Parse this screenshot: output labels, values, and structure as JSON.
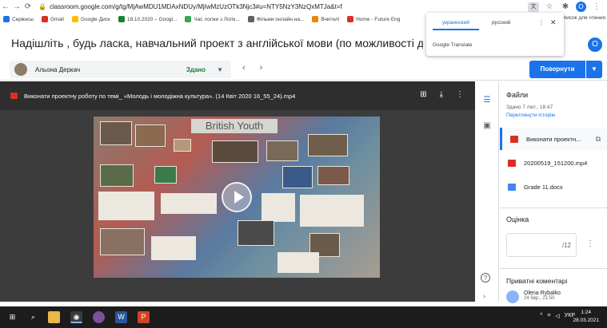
{
  "browser": {
    "url": "classroom.google.com/g/tg/MjAwMDU1MDAxNDUy/MjIwMzUzOTk3Njc3#u=NTY5NzY3NzQxMTJa&t=f",
    "bookmarks": [
      {
        "label": "Сервисы",
        "color": "#1a73e8"
      },
      {
        "label": "Gmail",
        "color": "#d93025"
      },
      {
        "label": "Google Диск",
        "color": "#fbbc04"
      },
      {
        "label": "18.10.2020 – Googl...",
        "color": "#188038"
      },
      {
        "label": "Час логіки з Логік...",
        "color": "#34a853"
      },
      {
        "label": "Фільми онлайн на...",
        "color": "#5f6368"
      },
      {
        "label": "Вчителі",
        "color": "#ea8600"
      },
      {
        "label": "Home - Future Eng",
        "color": "#d93025"
      }
    ],
    "bookmarks_more": "писок для чтения",
    "profile_letter": "O"
  },
  "translate": {
    "tab_active": "украинский",
    "tab_other": "русский",
    "brand": "Google Translate"
  },
  "header": {
    "title": "Надішліть , будь ласка, навчальний проект з англійської мови (по можливості додайте фото, від",
    "profile_letter": "O",
    "student_name": "Альона Деркач",
    "student_status": "Здано",
    "return_label": "Повернути"
  },
  "video": {
    "file_name": "Виконати проектну роботу по темі_ «Молодь і молодіжна культура». (14 Квіт 2020 16_55_24).mp4",
    "poster_title": "British Youth"
  },
  "panel": {
    "files_title": "Файли",
    "submitted": "Здано 7 лют., 18:47",
    "history_link": "Переглянути історію",
    "files": [
      {
        "name": "Виконати проектн...",
        "color": "#d93025"
      },
      {
        "name": "20200519_151200.mp4",
        "color": "#d93025"
      },
      {
        "name": "Grade 11.docx",
        "color": "#4285f4"
      }
    ],
    "grade_title": "Оцінка",
    "grade_value": "/12",
    "private_title": "Приватні коментарі",
    "comment_author": "Olena Rybalko",
    "comment_time": "24 бер., 21:50"
  },
  "taskbar": {
    "lang": "УКР",
    "time": "1:24",
    "date": "28.03.2021"
  }
}
